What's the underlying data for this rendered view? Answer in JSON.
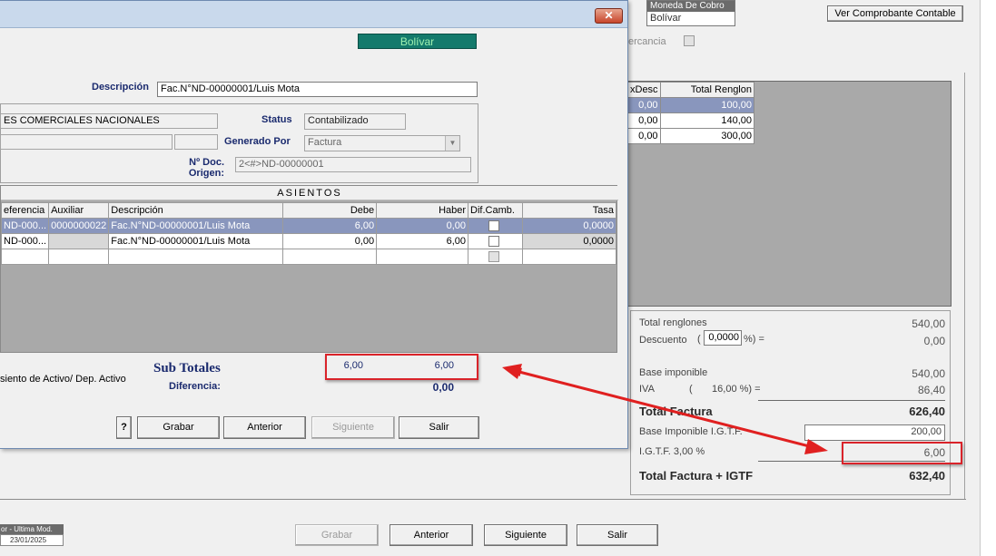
{
  "background": {
    "moneda_header": "Moneda De Cobro",
    "moneda_value": "Bolívar",
    "ver_comprobante_label": "Ver Comprobante Contable",
    "mercancia_fragment": "ercancia",
    "items_table": {
      "headers": [
        "xDesc",
        "Total Renglon"
      ],
      "rows": [
        [
          "0,00",
          "100,00"
        ],
        [
          "0,00",
          "140,00"
        ],
        [
          "0,00",
          "300,00"
        ]
      ]
    },
    "totals": {
      "total_renglones_label": "Total renglones",
      "total_renglones_value": "540,00",
      "descuento_label": "Descuento",
      "descuento_open": "(",
      "descuento_pct": "0,0000",
      "descuento_close": "%) =",
      "descuento_value": "0,00",
      "base_imponible_label": "Base imponible",
      "base_imponible_value": "540,00",
      "iva_label": "IVA",
      "iva_pct": "(       16,00 %) =",
      "iva_value": "86,40",
      "total_factura_label": "Total Factura",
      "total_factura_value": "626,40",
      "base_igtf_label": "Base Imponible I.G.T.F.",
      "base_igtf_value": "200,00",
      "igtf_label": "I.G.T.F. 3,00 %",
      "igtf_value": "6,00",
      "total_igtf_label": "Total Factura + IGTF",
      "total_igtf_value": "632,40"
    },
    "footer_buttons": {
      "grabar": "Grabar",
      "anterior": "Anterior",
      "siguiente": "Siguiente",
      "salir": "Salir"
    },
    "history": {
      "header": "or - Ultima Mod.",
      "date": "23/01/2025"
    }
  },
  "dialog": {
    "close_glyph": "✕",
    "currency_label": "Bolívar",
    "descripcion_label": "Descripción",
    "descripcion_value": "Fac.N°ND-00000001/Luis Mota",
    "account_name": "ES COMERCIALES NACIONALES",
    "status_label": "Status",
    "status_value": "Contabilizado",
    "generado_por_label": "Generado Por",
    "generado_por_value": "Factura",
    "nro_doc_label_1": "Nº Doc.",
    "nro_doc_label_2": "Origen:",
    "nro_doc_value": "2<#>ND-00000001",
    "asientos_title": "ASIENTOS",
    "grid": {
      "headers": [
        "eferencia",
        "Auxiliar",
        "Descripción",
        "Debe",
        "Haber",
        "Dif.Camb.",
        "Tasa"
      ],
      "rows": [
        {
          "ref": "ND-000...",
          "aux": "0000000022",
          "desc": "Fac.N°ND-00000001/Luis Mota",
          "debe": "6,00",
          "haber": "0,00",
          "tasa": "0,0000"
        },
        {
          "ref": "ND-000...",
          "aux": "",
          "desc": "Fac.N°ND-00000001/Luis Mota",
          "debe": "0,00",
          "haber": "6,00",
          "tasa": "0,0000"
        }
      ]
    },
    "activo_note": "siento de Activo/ Dep. Activo",
    "sub_totales_label": "Sub Totales",
    "sub_debe": "6,00",
    "sub_haber": "6,00",
    "diferencia_label": "Diferencia:",
    "diferencia_value": "0,00",
    "help_label": "?",
    "buttons": {
      "grabar": "Grabar",
      "anterior": "Anterior",
      "siguiente": "Siguiente",
      "salir": "Salir"
    }
  },
  "colors": {
    "highlight": "#d9232a",
    "selected_row": "#8996bd",
    "currency_bg": "#147a6c"
  }
}
